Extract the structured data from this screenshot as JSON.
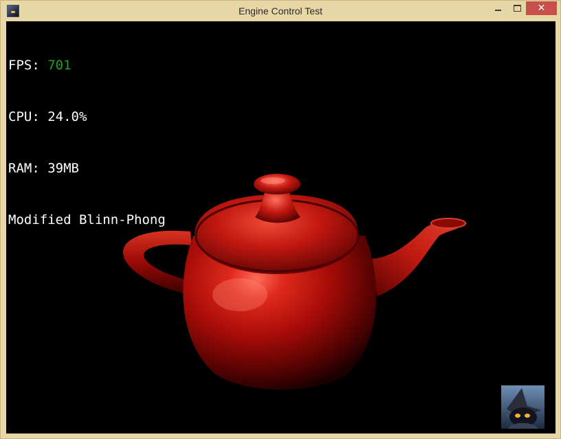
{
  "window": {
    "title": "Engine Control Test",
    "close_symbol": "✕"
  },
  "hud": {
    "fps_label": "FPS: ",
    "fps_value": "701",
    "cpu_text": "CPU: 24.0%",
    "ram_text": "RAM: 39MB",
    "shader_text": "Modified Blinn-Phong"
  },
  "colors": {
    "fps_value": "#22a022",
    "teapot": "#c41010",
    "viewport_bg": "#000000"
  },
  "icons": {
    "app": "wizard-app-icon",
    "minimize": "minimize-icon",
    "maximize": "maximize-icon",
    "close": "close-icon",
    "avatar": "wizard-avatar"
  }
}
